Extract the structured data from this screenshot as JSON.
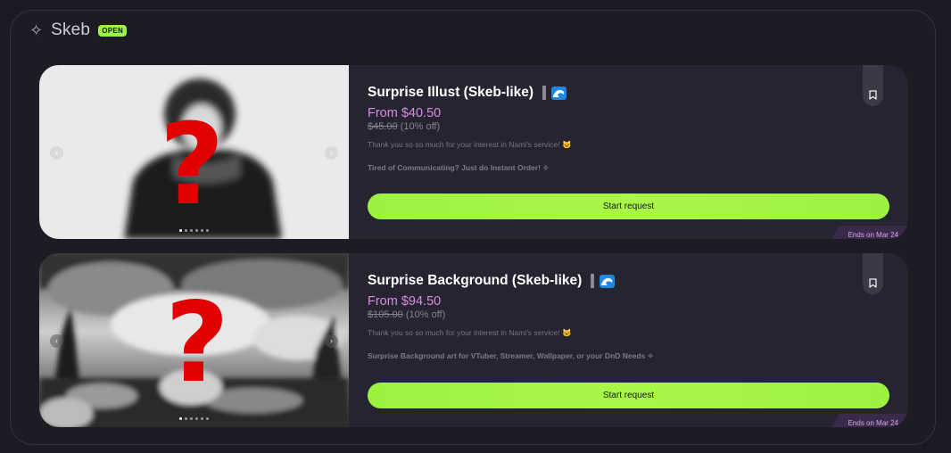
{
  "header": {
    "icon": "sparkle-icon",
    "title": "Skeb",
    "badge": "OPEN"
  },
  "colors": {
    "accent": "#9cf34a",
    "price": "#d88ee6",
    "question_mark": "#e00000",
    "ends_bg": "#3a2a4a"
  },
  "cards": [
    {
      "name": "Surprise Illust (Skeb-like)",
      "price": "From $40.50",
      "old_price": "$45.00",
      "discount": "(10% off)",
      "desc1": "Thank you so so much for your interest in Nami's service! 🐱",
      "desc2": "Tired of Communicating? Just do Instant Order! ✧",
      "button": "Start request",
      "ends": "Ends on Mar 24",
      "carousel_dots": 6,
      "active_dot": 0
    },
    {
      "name": "Surprise Background (Skeb-like)",
      "price": "From $94.50",
      "old_price": "$105.00",
      "discount": "(10% off)",
      "desc1": "Thank you so so much for your interest in Nami's service! 🐱",
      "desc2": "Surprise Background art for VTuber, Streamer, Wallpaper, or your DnD Needs ✧",
      "button": "Start request",
      "ends": "Ends on Mar 24",
      "carousel_dots": 6,
      "active_dot": 0
    }
  ],
  "icons": {
    "arrow_left": "‹",
    "arrow_right": "›",
    "question": "?"
  }
}
